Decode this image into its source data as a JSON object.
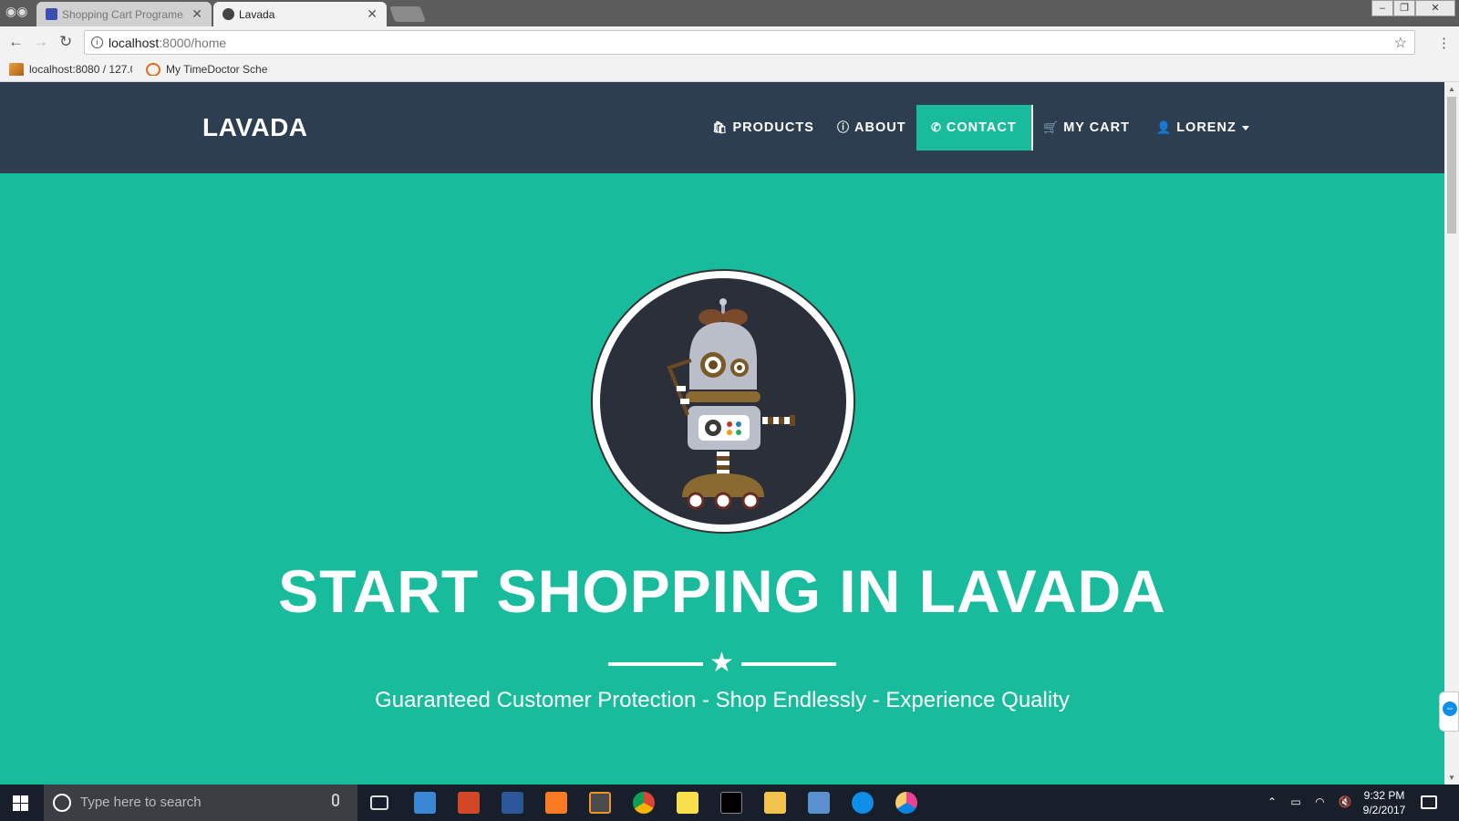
{
  "browser": {
    "tabs": [
      {
        "title": "Shopping Cart Programe",
        "active": false
      },
      {
        "title": "Lavada",
        "active": true
      }
    ],
    "url_host": "localhost",
    "url_path": ":8000/home",
    "bookmarks": [
      "localhost:8080 / 127.0",
      "My TimeDoctor Sche"
    ]
  },
  "site": {
    "brand": "LAVADA",
    "nav": {
      "products": "PRODUCTS",
      "about": "ABOUT",
      "contact": "CONTACT",
      "cart": "MY CART",
      "user": "LORENZ"
    },
    "hero_title": "START SHOPPING IN LAVADA",
    "hero_subtitle": "Guaranteed Customer Protection - Shop Endlessly - Experience Quality",
    "colors": {
      "navbar": "#2c3e50",
      "accent": "#18bc9c"
    }
  },
  "taskbar": {
    "search_placeholder": "Type here to search",
    "time": "9:32 PM",
    "date": "9/2/2017"
  }
}
